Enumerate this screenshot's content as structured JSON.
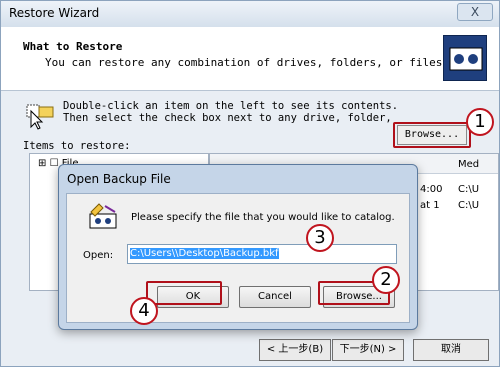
{
  "window": {
    "title": "Restore Wizard",
    "close_label": "X"
  },
  "header": {
    "heading": "What to Restore",
    "subheading": "You can restore any combination of drives, folders, or files."
  },
  "instructions": {
    "line1": "Double-click an item on the left to see its contents.",
    "line2": "Then select the check box next to any drive, folder,"
  },
  "browse_label": "Browse...",
  "items_label": "Items to restore:",
  "tree": {
    "item_label": "File"
  },
  "list": {
    "column_media": "Med",
    "rows": [
      {
        "time": "4:00",
        "media": "C:\\U"
      },
      {
        "time": "at 1",
        "media": "C:\\U"
      }
    ]
  },
  "wizard_buttons": {
    "back": "< 上一步(B)",
    "next": "下一步(N) >",
    "cancel": "取消"
  },
  "dialog": {
    "title": "Open Backup File",
    "message": "Please specify the file that you would like to catalog.",
    "open_label": "Open:",
    "path": "C:\\Users\\",
    "path_selected": "C:\\Users\\\\Desktop\\Backup.bkf",
    "ok": "OK",
    "cancel": "Cancel",
    "browse": "Browse..."
  },
  "markers": [
    "1",
    "2",
    "3",
    "4"
  ],
  "colors": {
    "highlight_red": "#b0101a",
    "selection_blue": "#3399ff"
  }
}
